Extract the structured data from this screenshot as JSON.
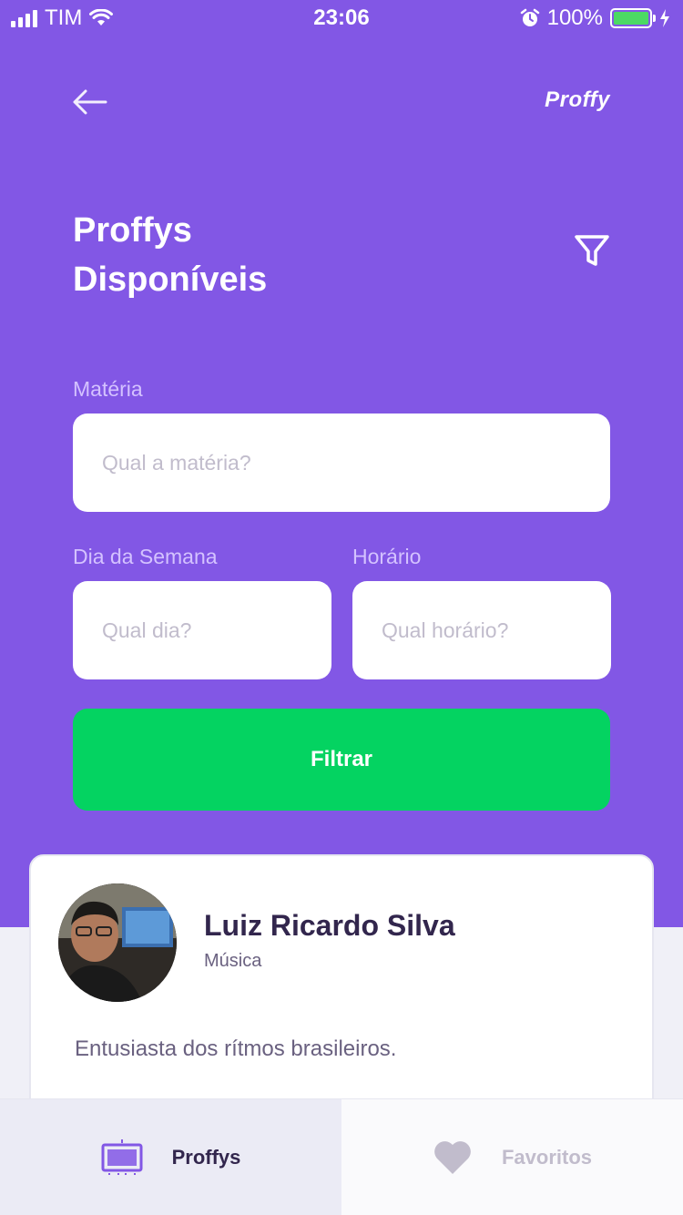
{
  "status_bar": {
    "carrier": "TIM",
    "time": "23:06",
    "battery": "100%"
  },
  "header": {
    "logo": "Proffy",
    "title_line1": "Proffys",
    "title_line2": "Disponíveis"
  },
  "form": {
    "subject": {
      "label": "Matéria",
      "placeholder": "Qual a matéria?"
    },
    "weekday": {
      "label": "Dia da Semana",
      "placeholder": "Qual dia?"
    },
    "time": {
      "label": "Horário",
      "placeholder": "Qual horário?"
    },
    "submit_label": "Filtrar"
  },
  "teachers": [
    {
      "name": "Luiz Ricardo Silva",
      "subject": "Música",
      "bio": "Entusiasta dos rítmos brasileiros."
    }
  ],
  "tabs": [
    {
      "label": "Proffys",
      "icon": "tv-icon",
      "active": true
    },
    {
      "label": "Favoritos",
      "icon": "heart-icon",
      "active": false
    }
  ],
  "colors": {
    "primary": "#8257e5",
    "secondary": "#04d361",
    "text_title": "#32264d",
    "text_muted": "#6a6180",
    "placeholder": "#c1bccc"
  }
}
